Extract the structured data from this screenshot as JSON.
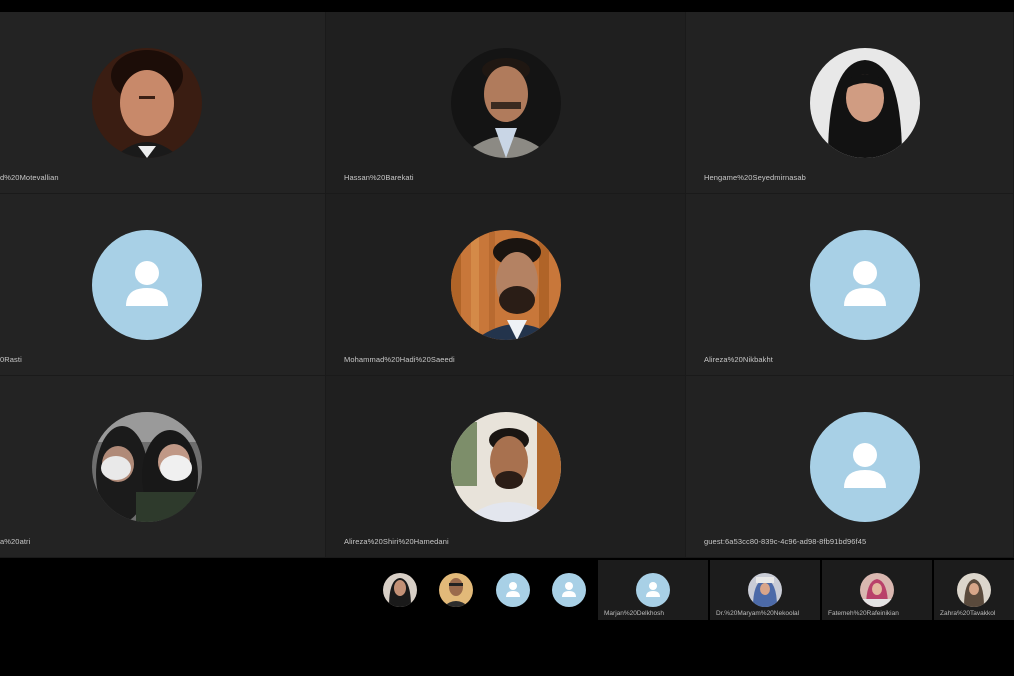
{
  "participants": [
    {
      "name": "d%20Motevallian",
      "avatar": "photo",
      "icon": "person-photo-icon"
    },
    {
      "name": "Hassan%20Barekati",
      "avatar": "photo",
      "icon": "person-photo-icon"
    },
    {
      "name": "Hengame%20Seyedmirnasab",
      "avatar": "photo",
      "icon": "person-photo-icon"
    },
    {
      "name": "0Rasti",
      "avatar": "generic",
      "icon": "default-user-icon"
    },
    {
      "name": "Mohammad%20Hadi%20Saeedi",
      "avatar": "photo",
      "icon": "person-photo-icon"
    },
    {
      "name": "Alireza%20Nikbakht",
      "avatar": "generic",
      "icon": "default-user-icon"
    },
    {
      "name": "a%20atri",
      "avatar": "photo",
      "icon": "person-photo-icon"
    },
    {
      "name": "Alireza%20Shiri%20Hamedani",
      "avatar": "photo",
      "icon": "person-photo-icon"
    },
    {
      "name": "guest:6a53cc80-839c-4c96-ad98-8fb91bd96f45",
      "avatar": "generic",
      "icon": "default-user-icon"
    }
  ],
  "strip": {
    "thumbs": [
      {
        "avatar": "photo",
        "icon": "person-photo-icon"
      },
      {
        "avatar": "photo",
        "icon": "person-photo-icon"
      },
      {
        "avatar": "generic",
        "icon": "default-user-icon"
      },
      {
        "avatar": "generic",
        "icon": "default-user-icon"
      }
    ],
    "named": [
      {
        "name": "Marjan%20Delkhosh",
        "avatar": "generic"
      },
      {
        "name": "Dr.%20Maryam%20Nekoolal",
        "avatar": "photo"
      },
      {
        "name": "Fatemeh%20Rafeinikian",
        "avatar": "photo"
      },
      {
        "name": "Zahra%20Tavakkol",
        "avatar": "photo"
      }
    ]
  },
  "colors": {
    "background": "#000000",
    "tile": "#232323",
    "generic_avatar": "#a8d0e6",
    "name_text": "#c8c8c8"
  }
}
